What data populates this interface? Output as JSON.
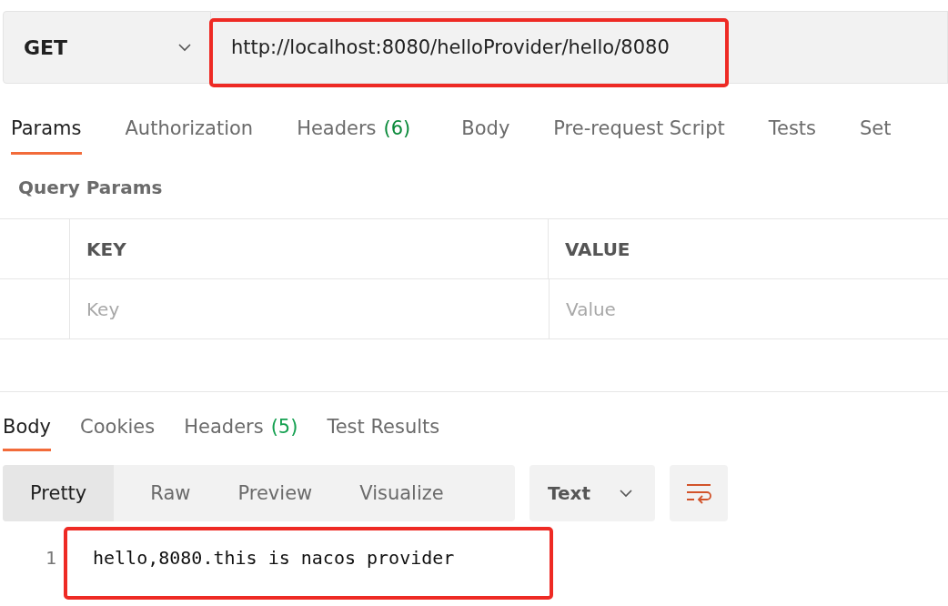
{
  "request": {
    "method": "GET",
    "url": "http://localhost:8080/helloProvider/hello/8080"
  },
  "request_tabs": [
    {
      "label": "Params",
      "selected": true
    },
    {
      "label": "Authorization",
      "selected": false
    },
    {
      "label": "Headers",
      "count": "(6)",
      "selected": false
    },
    {
      "label": "Body",
      "selected": false
    },
    {
      "label": "Pre-request Script",
      "selected": false
    },
    {
      "label": "Tests",
      "selected": false
    },
    {
      "label": "Set",
      "selected": false
    }
  ],
  "query_params": {
    "title": "Query Params",
    "columns": [
      "KEY",
      "VALUE"
    ],
    "placeholders": [
      "Key",
      "Value"
    ]
  },
  "response_tabs": [
    {
      "label": "Body",
      "selected": true
    },
    {
      "label": "Cookies",
      "selected": false
    },
    {
      "label": "Headers",
      "count": "(5)",
      "selected": false
    },
    {
      "label": "Test Results",
      "selected": false
    }
  ],
  "view_modes": [
    {
      "label": "Pretty",
      "selected": true
    },
    {
      "label": "Raw",
      "selected": false
    },
    {
      "label": "Preview",
      "selected": false
    },
    {
      "label": "Visualize",
      "selected": false
    }
  ],
  "format": "Text",
  "response_lines": [
    {
      "number": "1",
      "text": "hello,8080.this is nacos provider"
    }
  ]
}
